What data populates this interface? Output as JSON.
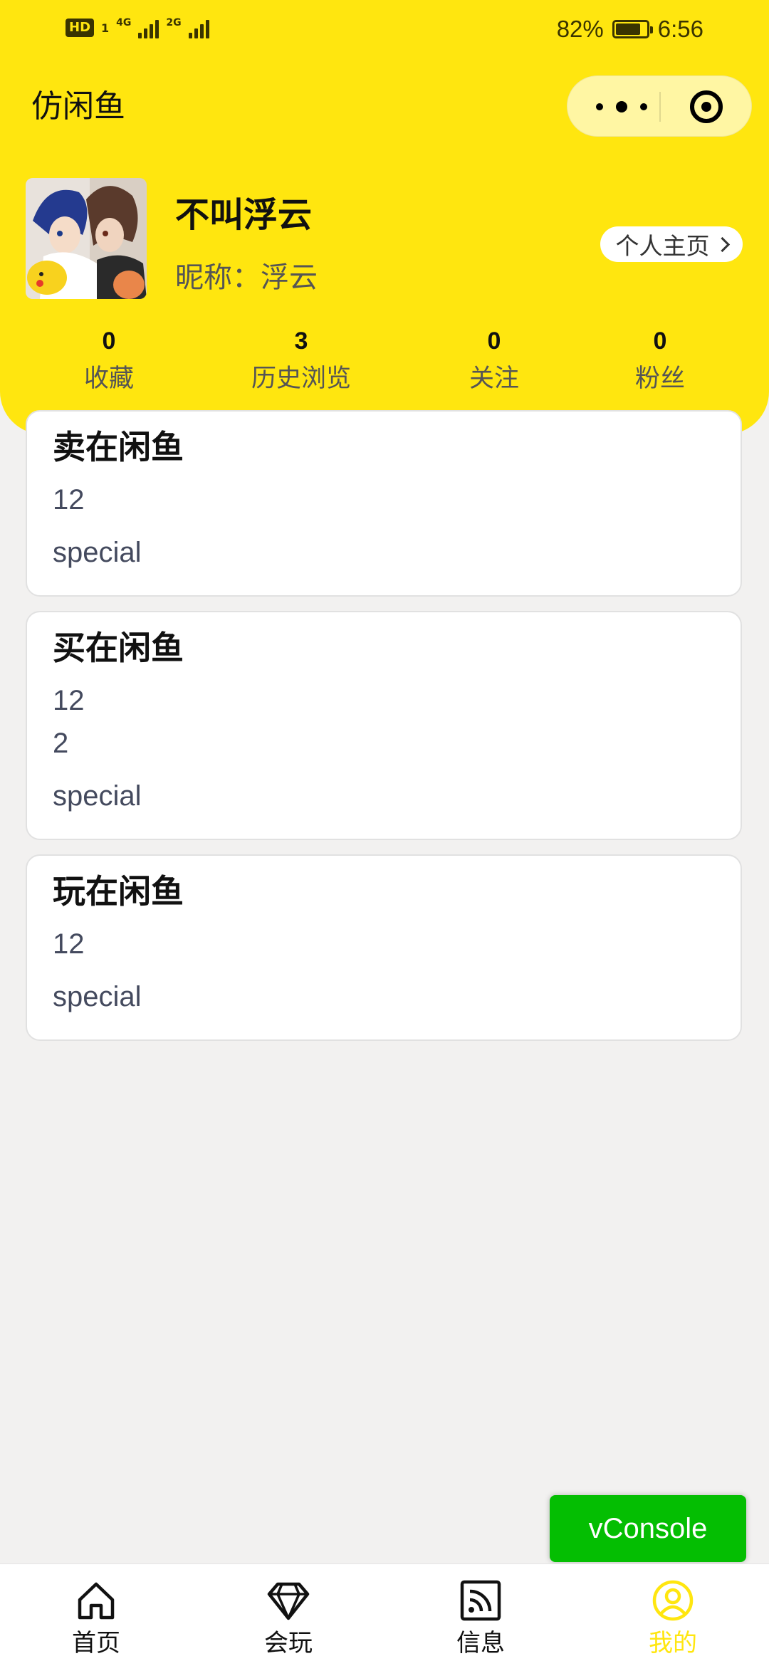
{
  "status_bar": {
    "hd_label": "HD",
    "sim_label": "1",
    "net_1": "4G",
    "net_2": "2G",
    "battery_percent": "82%",
    "battery_level": 0.82,
    "time": "6:56"
  },
  "nav": {
    "title": "仿闲鱼",
    "more_icon": "more-dots-icon",
    "close_icon": "target-circle-icon"
  },
  "profile": {
    "username": "不叫浮云",
    "nickname": "昵称：浮云",
    "homepage_button": "个人主页"
  },
  "stats": [
    {
      "value": "0",
      "label": "收藏"
    },
    {
      "value": "3",
      "label": "历史浏览"
    },
    {
      "value": "0",
      "label": "关注"
    },
    {
      "value": "0",
      "label": "粉丝"
    }
  ],
  "cards": [
    {
      "title": "卖在闲鱼",
      "lines": [
        "12"
      ],
      "footer": "special"
    },
    {
      "title": "买在闲鱼",
      "lines": [
        "12",
        "2"
      ],
      "footer": "special"
    },
    {
      "title": "玩在闲鱼",
      "lines": [
        "12"
      ],
      "footer": "special"
    }
  ],
  "vconsole": "vConsole",
  "tabs": [
    {
      "label": "首页",
      "icon": "home-icon"
    },
    {
      "label": "会玩",
      "icon": "diamond-icon"
    },
    {
      "label": "信息",
      "icon": "rss-icon"
    },
    {
      "label": "我的",
      "icon": "user-circle-icon"
    }
  ],
  "colors": {
    "brand_yellow": "#ffe60f",
    "vconsole_green": "#04be02",
    "background": "#f2f1f0"
  }
}
